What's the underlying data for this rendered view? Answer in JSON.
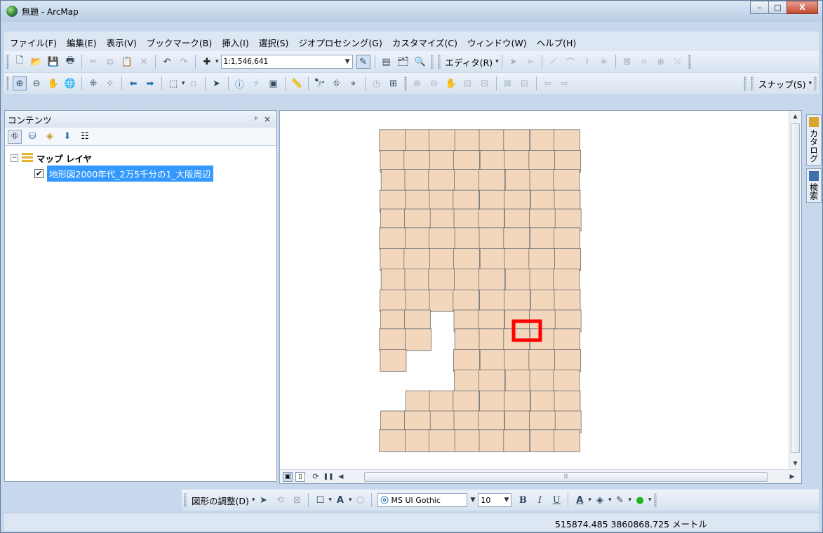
{
  "window": {
    "title": "無題 - ArcMap",
    "controls": {
      "minimize": "–",
      "maximize": "□",
      "close": "X"
    }
  },
  "menu": [
    "ファイル(F)",
    "編集(E)",
    "表示(V)",
    "ブックマーク(B)",
    "挿入(I)",
    "選択(S)",
    "ジオプロセシング(G)",
    "カスタマイズ(C)",
    "ウィンドウ(W)",
    "ヘルプ(H)"
  ],
  "standard_toolbar": {
    "scale_value": "1:1,546,641",
    "editor_label": "エディタ(R)"
  },
  "tools_toolbar": {
    "snapping_label": "スナップ(S)"
  },
  "toc": {
    "title": "コンテンツ",
    "pin": "ᵖ",
    "close": "×",
    "group_label": "マップ レイヤ",
    "layer_label": "地形図2000年代_2万5千分の1_大阪周辺",
    "layer_checked": true
  },
  "dock": {
    "catalog": "カタログ",
    "search": "検索"
  },
  "draw_toolbar": {
    "drawing_label": "図形の調整(D)",
    "font_name": "MS UI Gothic",
    "font_size": "10"
  },
  "status": {
    "coordinates": "515874.485  3860868.725 メートル"
  },
  "colors": {
    "tile_fill": "#f2d7bd",
    "tile_stroke": "#6e6e6e",
    "highlight": "#ff0000",
    "selection": "#3399ff"
  }
}
